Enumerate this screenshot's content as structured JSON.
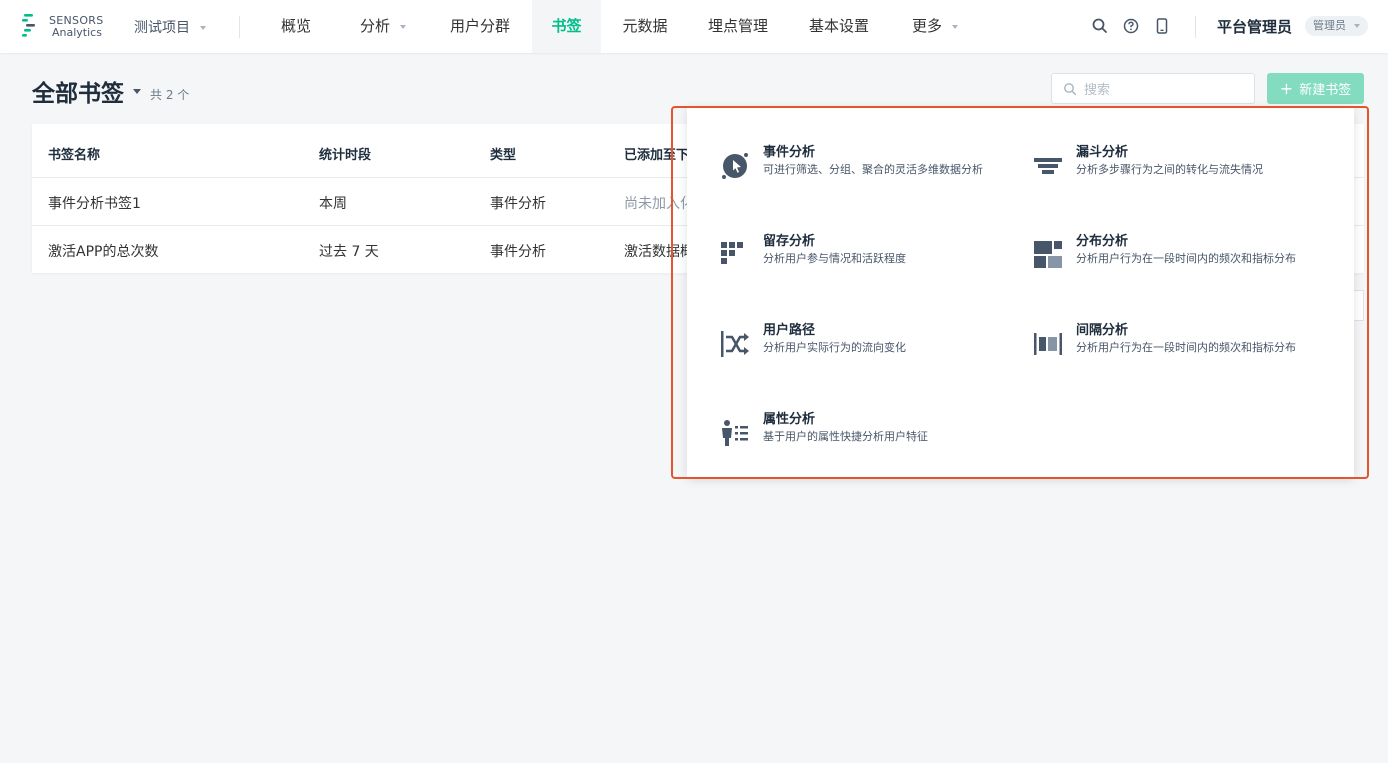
{
  "brand": {
    "name_line1": "SENSORS",
    "name_line2": "Analytics",
    "accent": "#00bf8a"
  },
  "project": {
    "label": "测试项目"
  },
  "nav": {
    "items": [
      {
        "label": "概览",
        "dropdown": false,
        "active": false
      },
      {
        "label": "分析",
        "dropdown": true,
        "active": false
      },
      {
        "label": "用户分群",
        "dropdown": false,
        "active": false
      },
      {
        "label": "书签",
        "dropdown": false,
        "active": true
      },
      {
        "label": "元数据",
        "dropdown": false,
        "active": false
      },
      {
        "label": "埋点管理",
        "dropdown": false,
        "active": false
      },
      {
        "label": "基本设置",
        "dropdown": false,
        "active": false
      },
      {
        "label": "更多",
        "dropdown": true,
        "active": false
      }
    ]
  },
  "user": {
    "name": "平台管理员",
    "role": "管理员"
  },
  "page": {
    "title": "全部书签",
    "count": "共 2 个"
  },
  "search": {
    "placeholder": "搜索",
    "value": ""
  },
  "actions": {
    "new_bookmark": "新建书签"
  },
  "table": {
    "headers": [
      "书签名称",
      "统计时段",
      "类型",
      "已添加至下"
    ],
    "rows": [
      {
        "name": "事件分析书签1",
        "period": "本周",
        "type": "事件分析",
        "added": "尚未加入化"
      },
      {
        "name": "激活APP的总次数",
        "period": "过去 7 天",
        "type": "事件分析",
        "added": "激活数据概"
      }
    ]
  },
  "popup": {
    "items": [
      {
        "title": "事件分析",
        "desc": "可进行筛选、分组、聚合的灵活多维数据分析",
        "icon": "event-analysis-icon"
      },
      {
        "title": "漏斗分析",
        "desc": "分析多步骤行为之间的转化与流失情况",
        "icon": "funnel-icon"
      },
      {
        "title": "留存分析",
        "desc": "分析用户参与情况和活跃程度",
        "icon": "retention-icon"
      },
      {
        "title": "分布分析",
        "desc": "分析用户行为在一段时间内的频次和指标分布",
        "icon": "distribution-icon"
      },
      {
        "title": "用户路径",
        "desc": "分析用户实际行为的流向变化",
        "icon": "user-path-icon"
      },
      {
        "title": "间隔分析",
        "desc": "分析用户行为在一段时间内的频次和指标分布",
        "icon": "interval-icon"
      },
      {
        "title": "属性分析",
        "desc": "基于用户的属性快捷分析用户特征",
        "icon": "attribute-icon"
      }
    ]
  },
  "colors": {
    "highlight_border": "#e5542c",
    "primary_button": "#83dcbf",
    "icon_dark": "#475669"
  }
}
